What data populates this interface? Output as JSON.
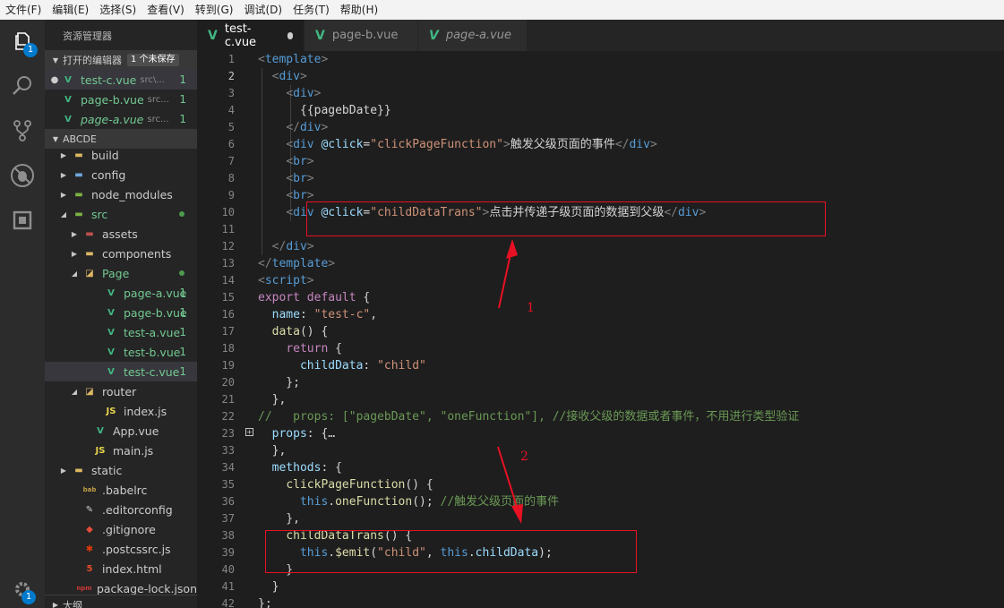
{
  "menu": [
    "文件(F)",
    "编辑(E)",
    "选择(S)",
    "查看(V)",
    "转到(G)",
    "调试(D)",
    "任务(T)",
    "帮助(H)"
  ],
  "activity": {
    "explorer_badge": "1",
    "settings_badge": "1"
  },
  "sidebar": {
    "title": "资源管理器",
    "open_editors_label": "打开的编辑器",
    "unsaved_label": "1 个未保存",
    "open_editors": [
      {
        "name": "test-c.vue",
        "path": "src\\...",
        "count": "1"
      },
      {
        "name": "page-b.vue",
        "path": "src...",
        "count": "1"
      },
      {
        "name": "page-a.vue",
        "path": "src...",
        "count": "1"
      }
    ],
    "project_label": "ABCDE",
    "tree": [
      {
        "name": "build"
      },
      {
        "name": "config"
      },
      {
        "name": "node_modules"
      },
      {
        "name": "src"
      },
      {
        "name": "assets"
      },
      {
        "name": "components"
      },
      {
        "name": "Page"
      },
      {
        "name": "page-a.vue",
        "count": "1"
      },
      {
        "name": "page-b.vue",
        "count": "1"
      },
      {
        "name": "test-a.vue",
        "count": "1"
      },
      {
        "name": "test-b.vue",
        "count": "1"
      },
      {
        "name": "test-c.vue",
        "count": "1"
      },
      {
        "name": "router"
      },
      {
        "name": "index.js"
      },
      {
        "name": "App.vue"
      },
      {
        "name": "main.js"
      },
      {
        "name": "static"
      },
      {
        "name": ".babelrc"
      },
      {
        "name": ".editorconfig"
      },
      {
        "name": ".gitignore"
      },
      {
        "name": ".postcssrc.js"
      },
      {
        "name": "index.html"
      },
      {
        "name": "package-lock.json"
      }
    ],
    "outline_label": "大纲"
  },
  "tabs": [
    {
      "label": "test-c.vue"
    },
    {
      "label": "page-b.vue"
    },
    {
      "label": "page-a.vue"
    }
  ],
  "editor": {
    "line_numbers": [
      "1",
      "2",
      "3",
      "4",
      "5",
      "6",
      "7",
      "8",
      "9",
      "10",
      "11",
      "12",
      "13",
      "14",
      "15",
      "16",
      "17",
      "18",
      "19",
      "20",
      "21",
      "22",
      "23",
      "33",
      "34",
      "35",
      "36",
      "37",
      "38",
      "39",
      "40",
      "41",
      "42",
      "43"
    ],
    "lines": [
      [
        [
          "t-brk",
          "<"
        ],
        [
          "t-tag",
          "template"
        ],
        [
          "t-brk",
          ">"
        ]
      ],
      [
        [
          "t-txt",
          "  "
        ],
        [
          "t-brk",
          "<"
        ],
        [
          "t-tag",
          "div"
        ],
        [
          "t-brk",
          ">"
        ]
      ],
      [
        [
          "t-txt",
          "    "
        ],
        [
          "t-brk",
          "<"
        ],
        [
          "t-tag",
          "div"
        ],
        [
          "t-brk",
          ">"
        ]
      ],
      [
        [
          "t-txt",
          "      {{pagebDate}}"
        ]
      ],
      [
        [
          "t-txt",
          "    "
        ],
        [
          "t-brk",
          "</"
        ],
        [
          "t-tag",
          "div"
        ],
        [
          "t-brk",
          ">"
        ]
      ],
      [
        [
          "t-txt",
          "    "
        ],
        [
          "t-brk",
          "<"
        ],
        [
          "t-tag",
          "div"
        ],
        [
          "t-txt",
          " "
        ],
        [
          "t-attr",
          "@click"
        ],
        [
          "t-txt",
          "="
        ],
        [
          "t-str",
          "\"clickPageFunction\""
        ],
        [
          "t-brk",
          ">"
        ],
        [
          "t-txt",
          "触发父级页面的事件"
        ],
        [
          "t-brk",
          "</"
        ],
        [
          "t-tag",
          "div"
        ],
        [
          "t-brk",
          ">"
        ]
      ],
      [
        [
          "t-txt",
          "    "
        ],
        [
          "t-brk",
          "<"
        ],
        [
          "t-tag",
          "br"
        ],
        [
          "t-brk",
          ">"
        ]
      ],
      [
        [
          "t-txt",
          "    "
        ],
        [
          "t-brk",
          "<"
        ],
        [
          "t-tag",
          "br"
        ],
        [
          "t-brk",
          ">"
        ]
      ],
      [
        [
          "t-txt",
          "    "
        ],
        [
          "t-brk",
          "<"
        ],
        [
          "t-tag",
          "br"
        ],
        [
          "t-brk",
          ">"
        ]
      ],
      [
        [
          "t-txt",
          "    "
        ],
        [
          "t-brk",
          "<"
        ],
        [
          "t-tag",
          "div"
        ],
        [
          "t-txt",
          " "
        ],
        [
          "t-attr",
          "@click"
        ],
        [
          "t-txt",
          "="
        ],
        [
          "t-str",
          "\"childDataTrans\""
        ],
        [
          "t-brk",
          ">"
        ],
        [
          "t-txt",
          "点击并传递子级页面的数据到父级"
        ],
        [
          "t-brk",
          "</"
        ],
        [
          "t-tag",
          "div"
        ],
        [
          "t-brk",
          ">"
        ]
      ],
      [
        [
          "t-txt",
          ""
        ]
      ],
      [
        [
          "t-txt",
          "  "
        ],
        [
          "t-brk",
          "</"
        ],
        [
          "t-tag",
          "div"
        ],
        [
          "t-brk",
          ">"
        ]
      ],
      [
        [
          "t-brk",
          "</"
        ],
        [
          "t-tag",
          "template"
        ],
        [
          "t-brk",
          ">"
        ]
      ],
      [
        [
          "t-brk",
          "<"
        ],
        [
          "t-tag",
          "script"
        ],
        [
          "t-brk",
          ">"
        ]
      ],
      [
        [
          "t-ctl",
          "export"
        ],
        [
          "t-txt",
          " "
        ],
        [
          "t-ctl",
          "default"
        ],
        [
          "t-txt",
          " {"
        ]
      ],
      [
        [
          "t-txt",
          "  "
        ],
        [
          "t-var",
          "name"
        ],
        [
          "t-txt",
          ": "
        ],
        [
          "t-str",
          "\"test-c\""
        ],
        [
          "t-txt",
          ","
        ]
      ],
      [
        [
          "t-txt",
          "  "
        ],
        [
          "t-fn",
          "data"
        ],
        [
          "t-txt",
          "() {"
        ]
      ],
      [
        [
          "t-txt",
          "    "
        ],
        [
          "t-ctl",
          "return"
        ],
        [
          "t-txt",
          " {"
        ]
      ],
      [
        [
          "t-txt",
          "      "
        ],
        [
          "t-var",
          "childData"
        ],
        [
          "t-txt",
          ": "
        ],
        [
          "t-str",
          "\"child\""
        ]
      ],
      [
        [
          "t-txt",
          "    };"
        ]
      ],
      [
        [
          "t-txt",
          "  },"
        ]
      ],
      [
        [
          "t-cmt",
          "//   props: [\"pagebDate\", \"oneFunction\"], //接收父级的数据或者事件，不用进行类型验证"
        ]
      ],
      [
        [
          "t-txt",
          "  "
        ],
        [
          "t-var",
          "props"
        ],
        [
          "t-txt",
          ": {"
        ],
        [
          "t-txt",
          "…"
        ]
      ],
      [
        [
          "t-txt",
          "  },"
        ]
      ],
      [
        [
          "t-txt",
          "  "
        ],
        [
          "t-var",
          "methods"
        ],
        [
          "t-txt",
          ": {"
        ]
      ],
      [
        [
          "t-txt",
          "    "
        ],
        [
          "t-fn",
          "clickPageFunction"
        ],
        [
          "t-txt",
          "() {"
        ]
      ],
      [
        [
          "t-txt",
          "      "
        ],
        [
          "t-kw",
          "this"
        ],
        [
          "t-txt",
          "."
        ],
        [
          "t-fn",
          "oneFunction"
        ],
        [
          "t-txt",
          "(); "
        ],
        [
          "t-cmt",
          "//触发父级页面的事件"
        ]
      ],
      [
        [
          "t-txt",
          "    },"
        ]
      ],
      [
        [
          "t-txt",
          "    "
        ],
        [
          "t-fn",
          "childDataTrans"
        ],
        [
          "t-txt",
          "() {"
        ]
      ],
      [
        [
          "t-txt",
          "      "
        ],
        [
          "t-kw",
          "this"
        ],
        [
          "t-txt",
          "."
        ],
        [
          "t-fn",
          "$emit"
        ],
        [
          "t-txt",
          "("
        ],
        [
          "t-str",
          "\"child\""
        ],
        [
          "t-txt",
          ", "
        ],
        [
          "t-kw",
          "this"
        ],
        [
          "t-txt",
          "."
        ],
        [
          "t-var",
          "childData"
        ],
        [
          "t-txt",
          ");"
        ]
      ],
      [
        [
          "t-txt",
          "    }"
        ]
      ],
      [
        [
          "t-txt",
          "  }"
        ]
      ],
      [
        [
          "t-txt",
          "};"
        ]
      ]
    ]
  },
  "annotations": {
    "label_1": "1",
    "label_2": "2"
  }
}
